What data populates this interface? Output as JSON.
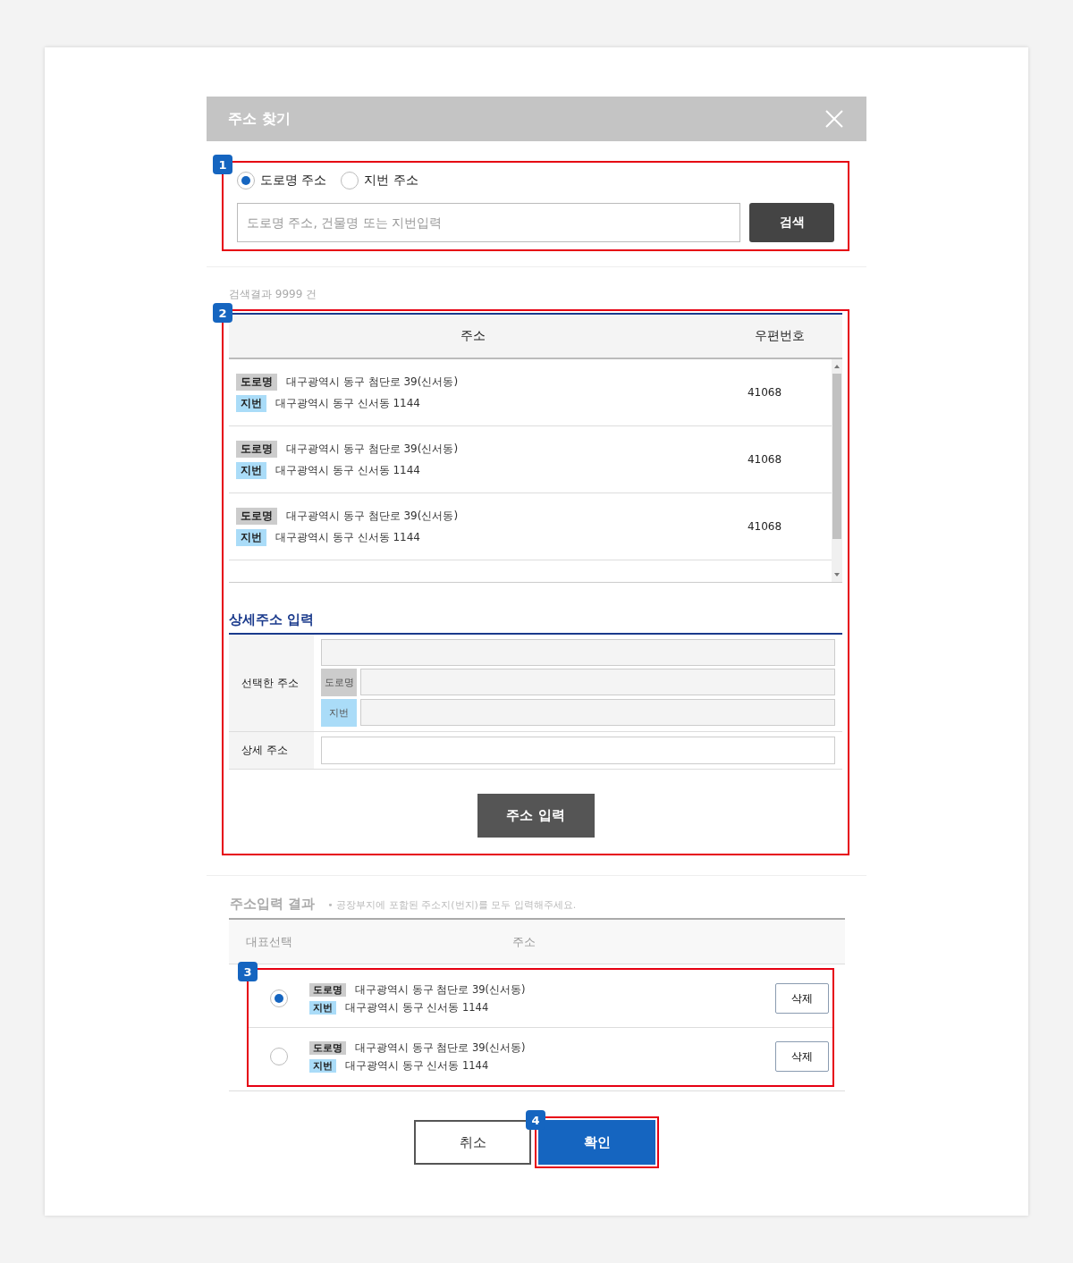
{
  "dialog": {
    "title": "주소 찾기"
  },
  "search": {
    "options": [
      {
        "label": "도로명 주소",
        "selected": true
      },
      {
        "label": "지번 주소",
        "selected": false
      }
    ],
    "placeholder": "도로명 주소, 건물명 또는 지번입력",
    "button": "검색"
  },
  "result_count": "검색결과 9999 건",
  "results_table": {
    "columns": [
      "주소",
      "우편번호"
    ],
    "rows": [
      {
        "road_tag": "도로명",
        "road": "대구광역시 동구 첨단로 39(신서동)",
        "lot_tag": "지번",
        "lot": "대구광역시 동구 신서동 1144",
        "postcode": "41068"
      },
      {
        "road_tag": "도로명",
        "road": "대구광역시 동구 첨단로 39(신서동)",
        "lot_tag": "지번",
        "lot": "대구광역시 동구 신서동 1144",
        "postcode": "41068"
      },
      {
        "road_tag": "도로명",
        "road": "대구광역시 동구 첨단로 39(신서동)",
        "lot_tag": "지번",
        "lot": "대구광역시 동구 신서동 1144",
        "postcode": "41068"
      }
    ]
  },
  "detail": {
    "title": "상세주소 입력",
    "selected_label": "선택한 주소",
    "road_tag": "도로명",
    "lot_tag": "지번",
    "detail_label": "상세 주소",
    "button": "주소 입력"
  },
  "entered": {
    "title": "주소입력 결과",
    "note": "• 공장부지에 포함된 주소지(번지)를 모두 입력해주세요.",
    "columns": [
      "대표선택",
      "주소"
    ],
    "rows": [
      {
        "selected": true,
        "road_tag": "도로명",
        "road": "대구광역시 동구 첨단로 39(신서동)",
        "lot_tag": "지번",
        "lot": "대구광역시 동구 신서동 1144",
        "delete": "삭제"
      },
      {
        "selected": false,
        "road_tag": "도로명",
        "road": "대구광역시 동구 첨단로 39(신서동)",
        "lot_tag": "지번",
        "lot": "대구광역시 동구 신서동 1144",
        "delete": "삭제"
      }
    ]
  },
  "actions": [
    {
      "label": "취소",
      "kind": "secondary"
    },
    {
      "label": "확인",
      "kind": "primary"
    }
  ],
  "annotations": [
    "1",
    "2",
    "3",
    "4"
  ]
}
